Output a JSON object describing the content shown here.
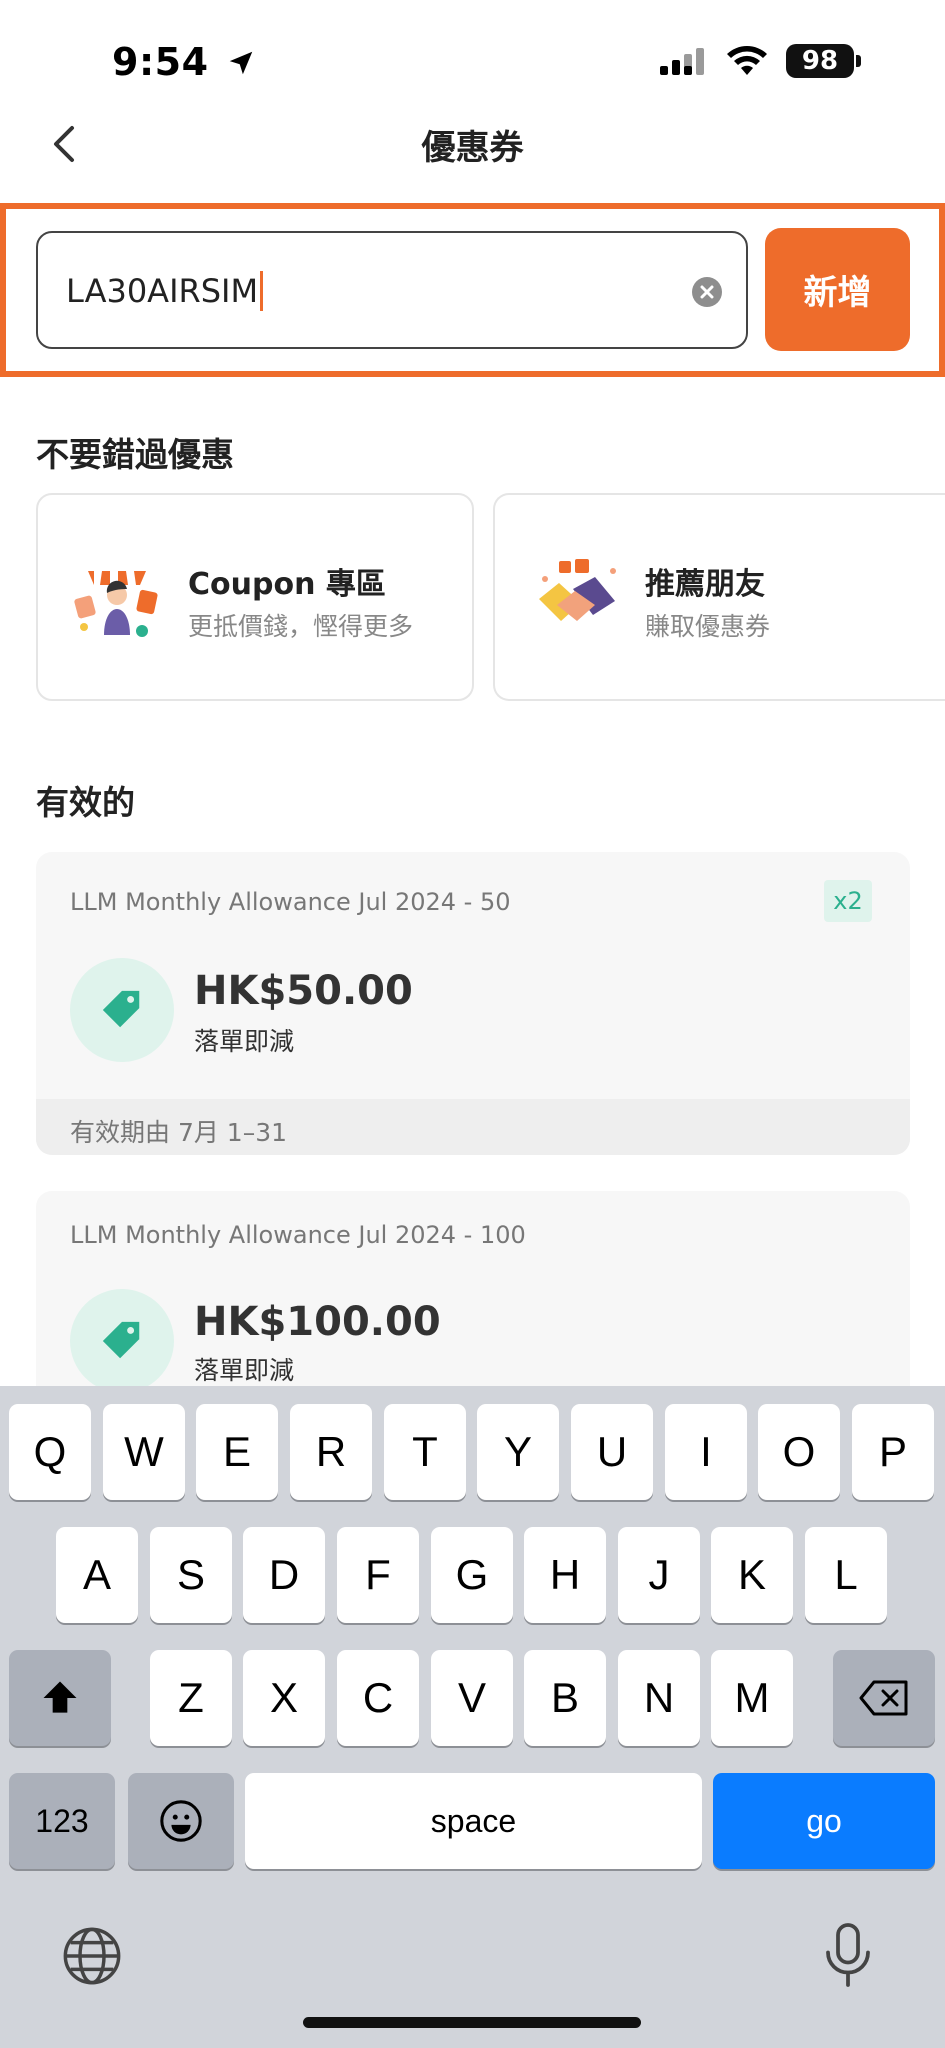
{
  "status_bar": {
    "time": "9:54",
    "battery": "98"
  },
  "nav": {
    "title": "優惠券"
  },
  "coupon_input": {
    "value": "LA30AIRSIM",
    "add_label": "新增"
  },
  "promo_section": {
    "title": "不要錯過優惠",
    "cards": [
      {
        "title": "Coupon 專區",
        "subtitle": "更抵價錢，慳得更多"
      },
      {
        "title": "推薦朋友",
        "subtitle": "賺取優惠券"
      }
    ]
  },
  "valid_section": {
    "title": "有效的",
    "vouchers": [
      {
        "name": "LLM Monthly Allowance Jul 2024 - 50",
        "badge": "x2",
        "amount": "HK$50.00",
        "description": "落單即減",
        "validity": "有效期由 7月 1–31"
      },
      {
        "name": "LLM Monthly Allowance Jul 2024 - 100",
        "amount": "HK$100.00",
        "description": "落單即減"
      }
    ]
  },
  "keyboard": {
    "row1": [
      "Q",
      "W",
      "E",
      "R",
      "T",
      "Y",
      "U",
      "I",
      "O",
      "P"
    ],
    "row2": [
      "A",
      "S",
      "D",
      "F",
      "G",
      "H",
      "J",
      "K",
      "L"
    ],
    "row3": [
      "Z",
      "X",
      "C",
      "V",
      "B",
      "N",
      "M"
    ],
    "numbers_label": "123",
    "space_label": "space",
    "go_label": "go"
  },
  "colors": {
    "accent": "#ee6c2b",
    "voucher_green": "#2bb08e",
    "keyboard_go": "#0a7cff"
  }
}
